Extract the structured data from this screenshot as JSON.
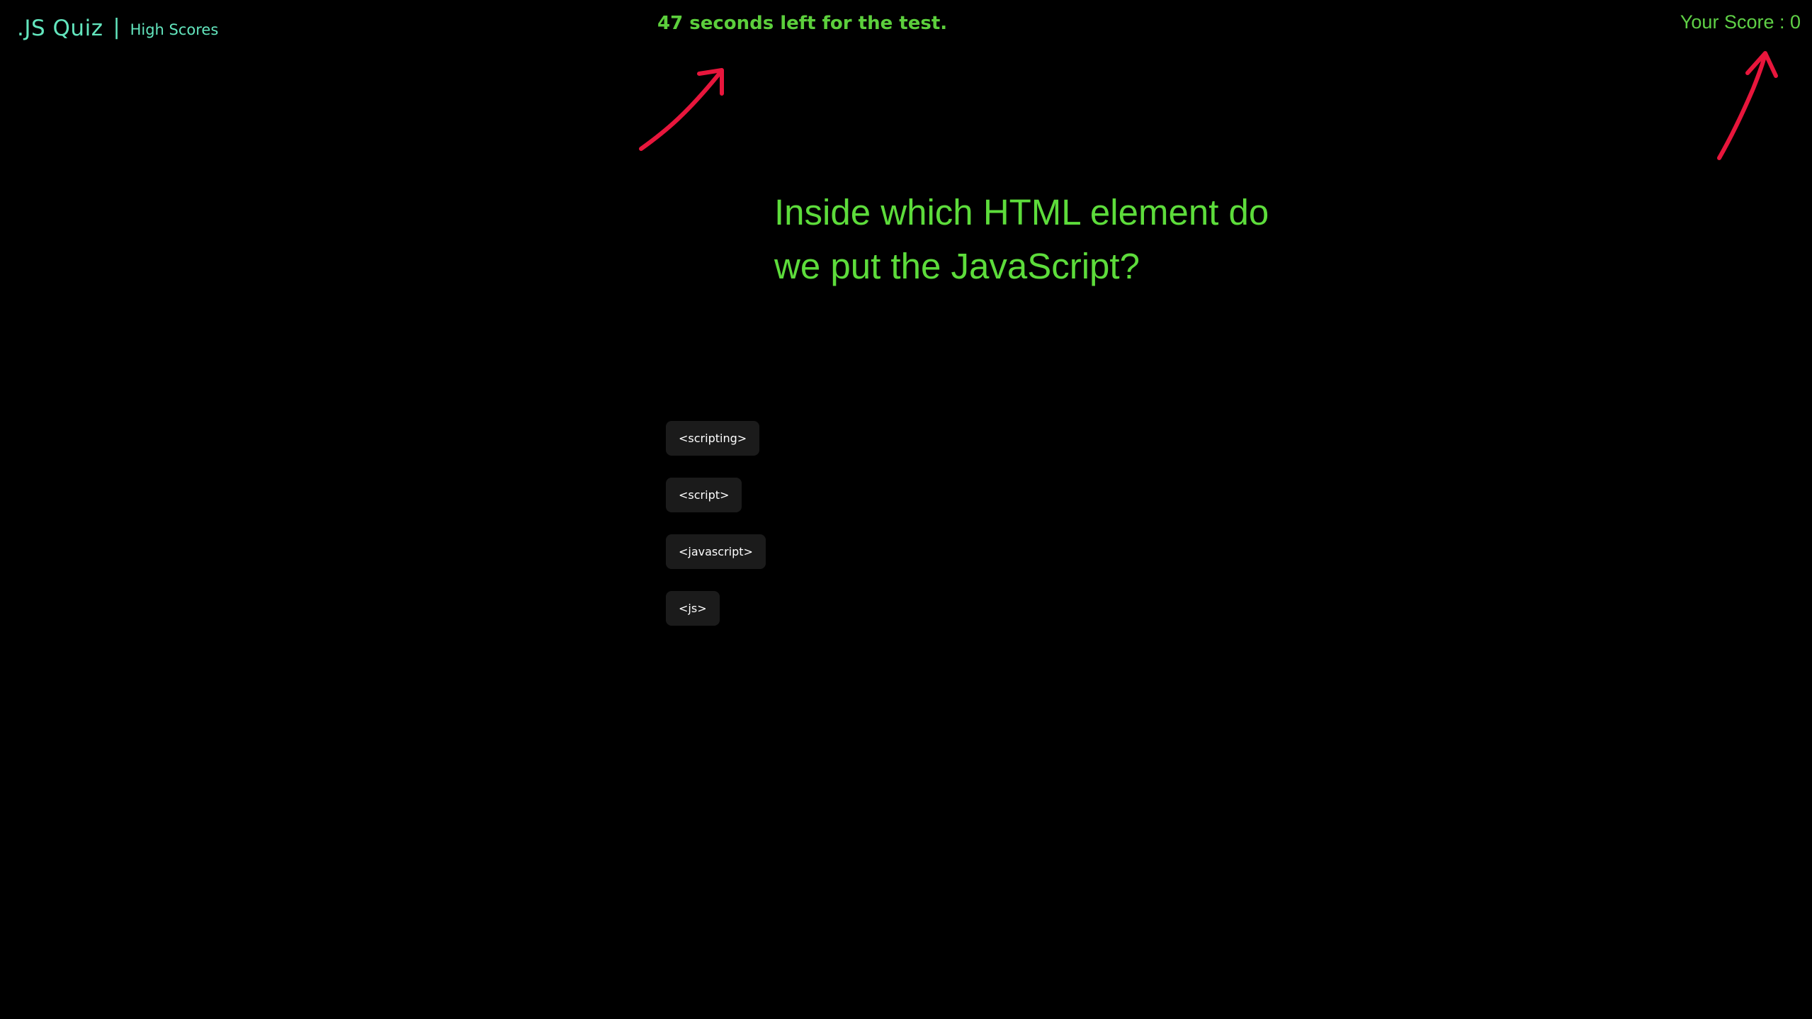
{
  "header": {
    "brand_title": ".JS Quiz",
    "separator": "|",
    "high_scores_link": "High Scores",
    "timer_text": "47 seconds left for the test.",
    "score_text": "Your Score : 0"
  },
  "quiz": {
    "question": "Inside which HTML element do we put the JavaScript?",
    "choices": [
      {
        "label": "<scripting>"
      },
      {
        "label": "<script>"
      },
      {
        "label": "<javascript>"
      },
      {
        "label": "<js>"
      }
    ]
  },
  "annotations": {
    "arrow_color": "#e8163c"
  },
  "colors": {
    "background": "#000000",
    "brand": "#63e6be",
    "accent_green": "#5ddc3b",
    "button_bg": "#1b1b1b",
    "button_text": "#ffffff"
  }
}
